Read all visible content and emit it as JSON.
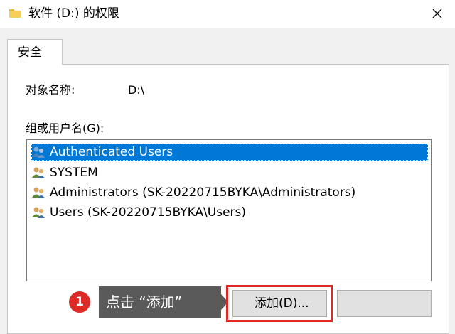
{
  "window": {
    "title": "软件 (D:) 的权限"
  },
  "tabs": [
    {
      "label": "安全"
    }
  ],
  "object": {
    "label": "对象名称:",
    "value": "D:\\"
  },
  "group": {
    "label": "组或用户名(G):",
    "users": [
      {
        "name": "Authenticated Users",
        "selected": true
      },
      {
        "name": "SYSTEM",
        "selected": false
      },
      {
        "name": "Administrators (SK-20220715BYKA\\Administrators)",
        "selected": false
      },
      {
        "name": "Users (SK-20220715BYKA\\Users)",
        "selected": false
      }
    ]
  },
  "annotation": {
    "step": "1",
    "text": "点击 “添加”"
  },
  "buttons": {
    "add": "添加(D)..."
  },
  "colors": {
    "selection": "#0078d7",
    "annotation_red": "#dd2a27",
    "callout_bg": "#5a5a5a"
  },
  "icons": {
    "window": "folder-icon",
    "close": "close-icon",
    "user": "user-group-icon"
  }
}
